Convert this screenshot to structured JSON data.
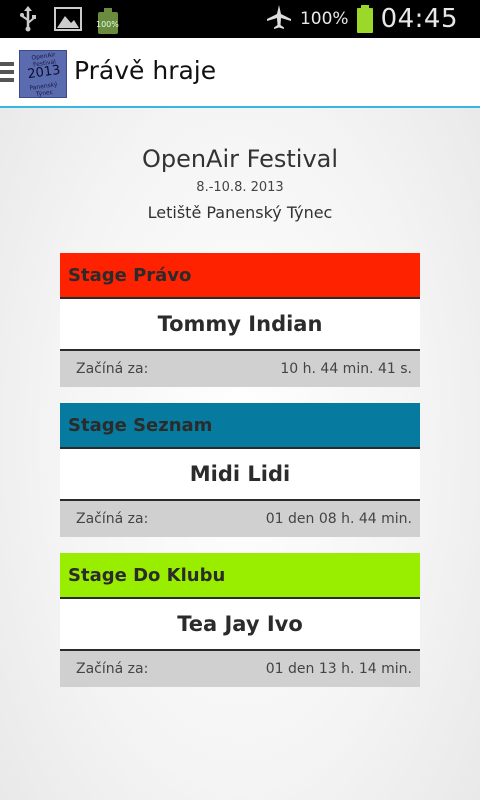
{
  "status_bar": {
    "battery_small_label": "100%",
    "battery_percent": "100%",
    "time": "04:45"
  },
  "app_bar": {
    "logo": {
      "top_text": "OpenAir Festival",
      "year": "2013",
      "bottom_text": "Panenský Týnec"
    },
    "title": "Právě hraje"
  },
  "festival": {
    "name": "OpenAir Festival",
    "dates": "8.-10.8. 2013",
    "place": "Letiště Panenský Týnec"
  },
  "stages": [
    {
      "name": "Stage Právo",
      "color": "#ff2200",
      "act": "Tommy Indian",
      "starts_label": "Začíná za:",
      "starts_value": "10 h. 44 min. 41 s."
    },
    {
      "name": "Stage Seznam",
      "color": "#077b9f",
      "act": "Midi Lidi",
      "starts_label": "Začíná za:",
      "starts_value": "01 den 08 h. 44 min."
    },
    {
      "name": "Stage Do Klubu",
      "color": "#99ee00",
      "act": "Tea Jay Ivo",
      "starts_label": "Začíná za:",
      "starts_value": "01 den 13 h. 14 min."
    }
  ],
  "icons": [
    "usb-icon",
    "image-icon",
    "battery-small-icon",
    "airplane-mode-icon",
    "battery-icon",
    "menu-icon",
    "app-logo"
  ],
  "colors": {
    "action_bar_divider": "#35b6e3",
    "footer_bg": "#d0d0d0"
  }
}
